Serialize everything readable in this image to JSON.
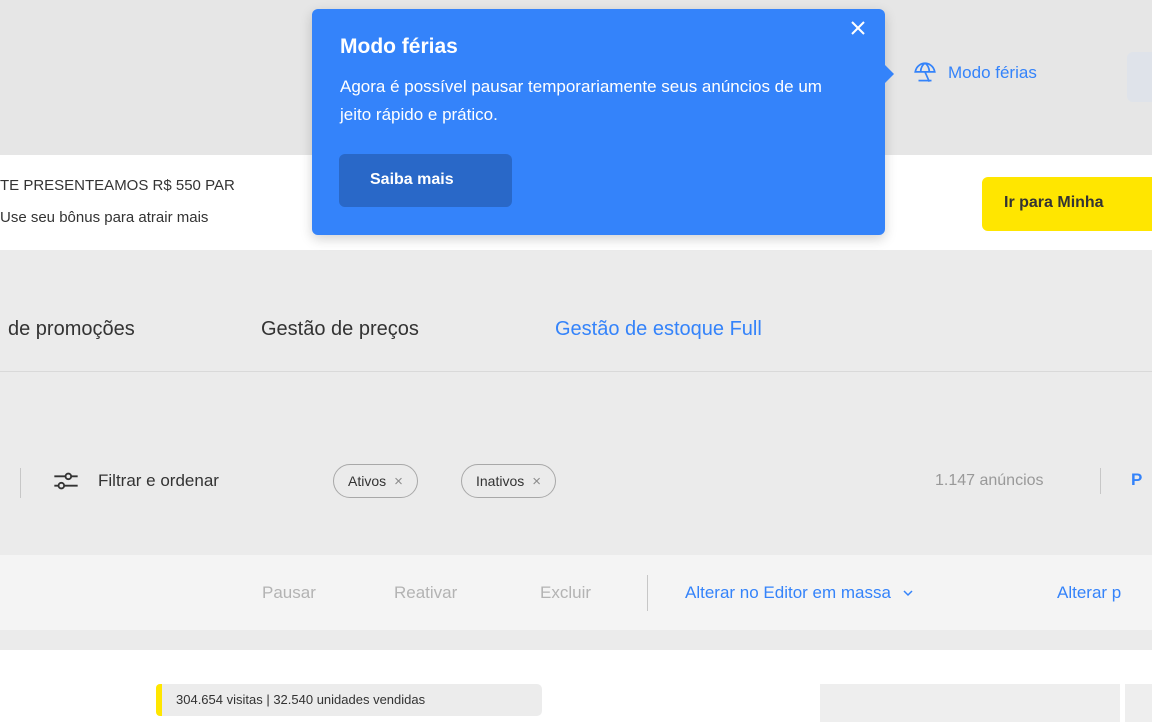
{
  "header": {
    "vacation_link": "Modo férias",
    "vacation_icon": "umbrella-icon"
  },
  "promo": {
    "line1": "TE PRESENTEAMOS R$ 550 PAR",
    "line2": "Use seu bônus para atrair mais",
    "cta": "Ir para Minha"
  },
  "tabs": [
    {
      "label": "de promoções"
    },
    {
      "label": "Gestão de preços"
    },
    {
      "label": "Gestão de estoque Full",
      "active": true
    }
  ],
  "filters": {
    "filter_label": "Filtrar e ordenar",
    "chips": [
      {
        "label": "Ativos",
        "remove": "×"
      },
      {
        "label": "Inativos",
        "remove": "×"
      }
    ],
    "count": "1.147 anúncios",
    "next_label": "P"
  },
  "actions": {
    "pause": "Pausar",
    "reactivate": "Reativar",
    "delete": "Excluir",
    "bulk_editor": "Alterar no Editor em massa",
    "alter": "Alterar p"
  },
  "listing": {
    "stats": "304.654 visitas | 32.540 unidades vendidas"
  },
  "tooltip": {
    "title": "Modo férias",
    "body": "Agora é possível pausar temporariamente seus anúncios de um jeito rápido e prático.",
    "button": "Saiba mais",
    "close_icon": "close-icon"
  },
  "colors": {
    "accent_blue": "#3483fa",
    "brand_yellow": "#ffe600"
  }
}
